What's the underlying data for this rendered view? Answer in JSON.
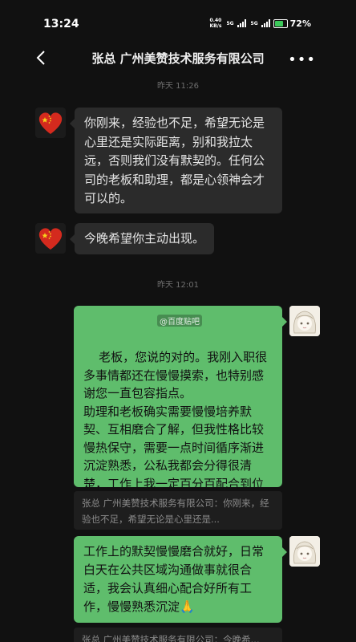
{
  "status": {
    "time": "13:24",
    "net_speed": "0.40",
    "net_unit": "KB/s",
    "gen1": "5G",
    "gen2": "5G",
    "battery": "72%",
    "battery_level": 0.72
  },
  "header": {
    "title": "张总 广州美赞技术服务有限公司"
  },
  "timestamps": {
    "t1": "昨天 11:26",
    "t2": "昨天 12:01"
  },
  "messages": {
    "m1": "你刚来，经验也不足，希望无论是心里还是实际距离，别和我拉太远，否则我们没有默契的。任何公司的老板和助理，都是心领神会才可以的。",
    "m2": "今晚希望你主动出现。",
    "m3": "老板，您说的对的。我刚入职很多事情都还在慢慢摸索，也特别感谢您一直包容指点。\n助理和老板确实需要慢慢培养默契、互相磨合了解，但我性格比较慢热保守，需要一点时间循序渐进沉淀熟悉，公私我都会分得很清楚，工作上我一定百分百配合到位❤️",
    "q1": "张总 广州美赞技术服务有限公司：你刚来，经验也不足，希望无论是心里还是...",
    "m4": "工作上的默契慢慢磨合就好，日常白天在公共区域沟通做事就很合适，我会认真细心配合好所有工作，慢慢熟悉沉淀🙏",
    "q2": "张总 广州美赞技术服务有限公司：今晚希..."
  },
  "watermark": "@百度贴吧",
  "icons": {
    "back": "chevron-left-icon",
    "more": "more-icon",
    "contact_avatar": "china-flag-heart-avatar",
    "self_avatar": "anime-girl-avatar"
  },
  "colors": {
    "background": "#111111",
    "bubble_in": "#2b2b2b",
    "bubble_out": "#5fbd6c",
    "quote_bg": "#1e1e1e"
  }
}
